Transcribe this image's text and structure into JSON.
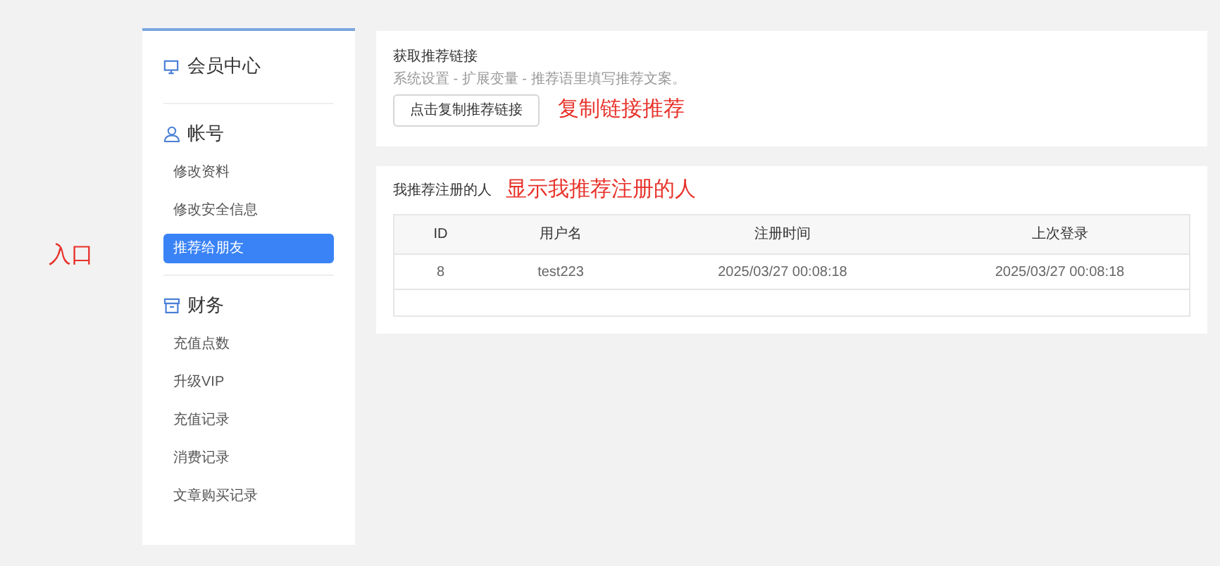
{
  "entry_annotation": "入口",
  "sidebar": {
    "title": "会员中心",
    "groups": [
      {
        "kind": "account",
        "label": "帐号",
        "items": [
          {
            "label": "修改资料",
            "selected": false
          },
          {
            "label": "修改安全信息",
            "selected": false
          },
          {
            "label": "推荐给朋友",
            "selected": true
          }
        ]
      },
      {
        "kind": "finance",
        "label": "财务",
        "items": [
          {
            "label": "充值点数",
            "selected": false
          },
          {
            "label": "升级VIP",
            "selected": false
          },
          {
            "label": "充值记录",
            "selected": false
          },
          {
            "label": "消费记录",
            "selected": false
          },
          {
            "label": "文章购买记录",
            "selected": false
          }
        ]
      }
    ]
  },
  "link_card": {
    "title": "获取推荐链接",
    "hint": "系统设置 - 扩展变量 - 推荐语里填写推荐文案。",
    "button": "点击复制推荐链接",
    "annotation": "复制链接推荐"
  },
  "referrals": {
    "title": "我推荐注册的人",
    "annotation": "显示我推荐注册的人",
    "columns": [
      "ID",
      "用户名",
      "注册时间",
      "上次登录"
    ],
    "rows": [
      [
        "8",
        "test223",
        "2025/03/27 00:08:18",
        "2025/03/27 00:08:18"
      ]
    ]
  }
}
